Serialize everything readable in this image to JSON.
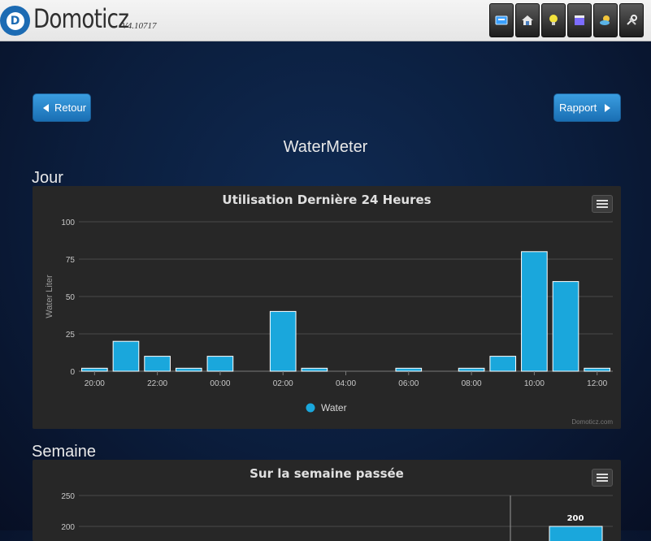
{
  "header": {
    "brand": "Domoticz",
    "version": "V4.10717"
  },
  "nav_icons": [
    "dashboard-icon",
    "floorplan-icon",
    "lightbulb-icon",
    "scenes-icon",
    "weather-icon",
    "setup-icon"
  ],
  "buttons": {
    "back": "Retour",
    "report": "Rapport"
  },
  "page_title": "WaterMeter",
  "sections": {
    "day": "Jour",
    "week": "Semaine"
  },
  "colors": {
    "bar": "#1aa7dc",
    "background": "#0b1d3c",
    "accent_button": "#2b8ad0"
  },
  "chart_data": [
    {
      "type": "bar",
      "title": "Utilisation Dernière 24 Heures",
      "ylabel": "Water Liter",
      "ylim": [
        0,
        100
      ],
      "yticks": [
        "0",
        "25",
        "50",
        "75",
        "100"
      ],
      "xtick_labels": [
        "20:00",
        "22:00",
        "00:00",
        "02:00",
        "04:00",
        "06:00",
        "08:00",
        "10:00",
        "12:00"
      ],
      "categories": [
        "20:00",
        "21:00",
        "22:00",
        "23:00",
        "00:00",
        "01:00",
        "02:00",
        "03:00",
        "04:00",
        "05:00",
        "06:00",
        "07:00",
        "08:00",
        "09:00",
        "10:00",
        "11:00",
        "12:00"
      ],
      "series": [
        {
          "name": "Water",
          "values": [
            2,
            20,
            10,
            2,
            10,
            0,
            40,
            2,
            0,
            0,
            2,
            0,
            2,
            10,
            80,
            60,
            2
          ]
        }
      ],
      "legend": "bottom-center",
      "credits": "Domoticz.com"
    },
    {
      "type": "bar",
      "title": "Sur la semaine passée",
      "yticks": [
        "200",
        "250"
      ],
      "data_label": "200"
    }
  ]
}
